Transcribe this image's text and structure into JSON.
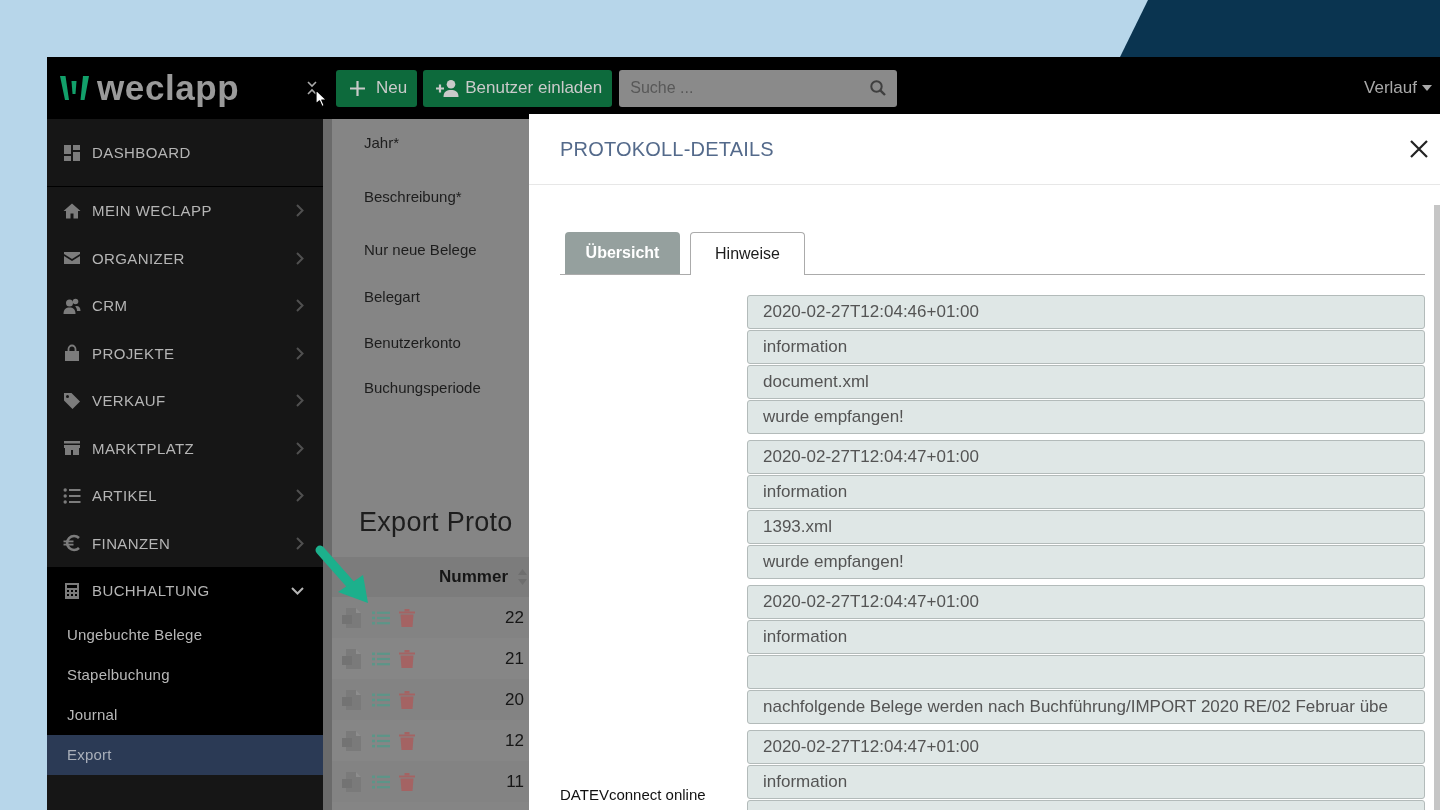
{
  "topbar": {
    "logo": "weclapp",
    "buttons": [
      {
        "kind": "new",
        "label": "Neu"
      },
      {
        "kind": "invite",
        "label": "Benutzer einladen"
      }
    ],
    "search": {
      "placeholder": "Suche ..."
    },
    "history_menu": "Verlauf"
  },
  "sidebar": {
    "items": [
      {
        "kind": "link",
        "label": "DASHBOARD"
      },
      {
        "kind": "menu",
        "label": "MEIN WECLAPP",
        "expanded": false
      },
      {
        "kind": "menu",
        "label": "ORGANIZER",
        "expanded": false
      },
      {
        "kind": "menu",
        "label": "CRM",
        "expanded": false
      },
      {
        "kind": "menu",
        "label": "PROJEKTE",
        "expanded": false
      },
      {
        "kind": "menu",
        "label": "VERKAUF",
        "expanded": false
      },
      {
        "kind": "menu",
        "label": "MARKTPLATZ",
        "expanded": false
      },
      {
        "kind": "menu",
        "label": "ARTIKEL",
        "expanded": false
      },
      {
        "kind": "menu",
        "label": "FINANZEN",
        "expanded": false
      },
      {
        "kind": "menu",
        "label": "BUCHHALTUNG",
        "expanded": true,
        "children": [
          {
            "label": "Ungebuchte Belege",
            "selected": false
          },
          {
            "label": "Stapelbuchung",
            "selected": false
          },
          {
            "label": "Journal",
            "selected": false
          },
          {
            "label": "Export",
            "selected": true
          }
        ]
      }
    ]
  },
  "form": {
    "labels": [
      "Jahr*",
      "Beschreibung*",
      "Nur neue Belege",
      "Belegart",
      "Benutzerkonto",
      "Buchungsperiode"
    ]
  },
  "export_table": {
    "title": "Export Proto",
    "columns": [
      "Nummer"
    ],
    "rows": [
      [
        "22"
      ],
      [
        "21"
      ],
      [
        "20"
      ],
      [
        "12"
      ],
      [
        "11"
      ]
    ]
  },
  "dialog": {
    "title": "PROTOKOLL-DETAILS",
    "tabs": [
      {
        "label": "Übersicht",
        "selected": false
      },
      {
        "label": "Hinweise",
        "selected": true
      }
    ],
    "groups": [
      {
        "fields": [
          {
            "kind": "text",
            "value": "2020-02-27T12:04:46+01:00"
          },
          {
            "kind": "text",
            "value": "information"
          },
          {
            "kind": "text",
            "value": "document.xml"
          },
          {
            "kind": "text",
            "value": "wurde empfangen!"
          }
        ]
      },
      {
        "fields": [
          {
            "kind": "text",
            "value": "2020-02-27T12:04:47+01:00"
          },
          {
            "kind": "text",
            "value": "information"
          },
          {
            "kind": "text",
            "value": "1393.xml"
          },
          {
            "kind": "text",
            "value": "wurde empfangen!"
          }
        ]
      },
      {
        "fields": [
          {
            "kind": "text",
            "value": "2020-02-27T12:04:47+01:00"
          },
          {
            "kind": "text",
            "value": "information"
          },
          {
            "kind": "blank"
          },
          {
            "kind": "text",
            "value": "nachfolgende Belege werden nach Buchführung/IMPORT 2020 RE/02 Februar übe"
          }
        ]
      },
      {
        "label": "DATEVconnect online",
        "fields": [
          {
            "kind": "text",
            "value": "2020-02-27T12:04:47+01:00"
          },
          {
            "kind": "text",
            "value": "information"
          },
          {
            "kind": "blank"
          }
        ]
      }
    ]
  }
}
